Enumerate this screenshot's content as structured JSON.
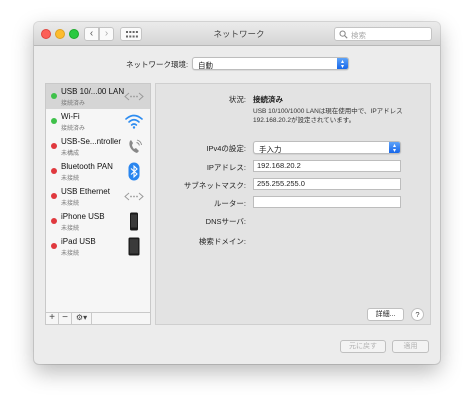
{
  "window": {
    "title": "ネットワーク",
    "search_placeholder": "検索"
  },
  "location": {
    "label": "ネットワーク環境:",
    "value": "自動"
  },
  "sidebar": {
    "items": [
      {
        "name": "USB 10/...00 LAN",
        "status": "接続済み",
        "status_color": "#3fc14a",
        "icon": "ethernet-icon"
      },
      {
        "name": "Wi-Fi",
        "status": "接続済み",
        "status_color": "#3fc14a",
        "icon": "wifi-icon"
      },
      {
        "name": "USB-Se...ntroller",
        "status": "未構成",
        "status_color": "#e0393e",
        "icon": "phone-icon"
      },
      {
        "name": "Bluetooth PAN",
        "status": "未接続",
        "status_color": "#e0393e",
        "icon": "bluetooth-icon"
      },
      {
        "name": "USB Ethernet",
        "status": "未接続",
        "status_color": "#e0393e",
        "icon": "ethernet-icon"
      },
      {
        "name": "iPhone USB",
        "status": "未接続",
        "status_color": "#e0393e",
        "icon": "iphone-icon"
      },
      {
        "name": "iPad USB",
        "status": "未接続",
        "status_color": "#e0393e",
        "icon": "ipad-icon"
      }
    ],
    "add_label": "+",
    "remove_label": "−",
    "action_label": "⚙▾"
  },
  "detail": {
    "status_label": "状況:",
    "status_value": "接続済み",
    "status_note_1": "USB 10/100/1000 LANは現在使用中で、IPアドレス",
    "status_note_2": "192.168.20.2が設定されています。",
    "ipv4_label": "IPv4の設定:",
    "ipv4_value": "手入力",
    "ip_label": "IPアドレス:",
    "ip_value": "192.168.20.2",
    "subnet_label": "サブネットマスク:",
    "subnet_value": "255.255.255.0",
    "router_label": "ルーター:",
    "router_value": "",
    "dns_label": "DNSサーバ:",
    "search_domain_label": "検索ドメイン:",
    "advanced_label": "詳細...",
    "help_label": "?"
  },
  "footer": {
    "revert_label": "元に戻す",
    "apply_label": "適用"
  }
}
